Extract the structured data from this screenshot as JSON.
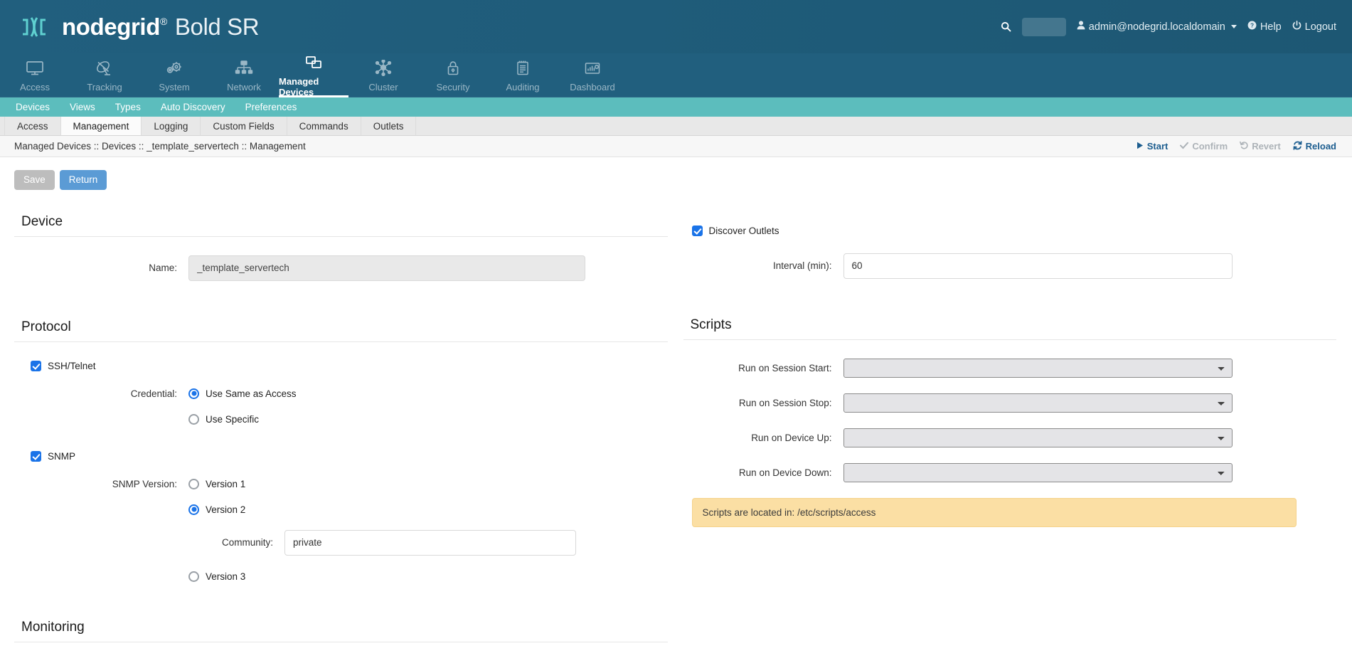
{
  "header": {
    "logo_brand": "nodegrid",
    "logo_reg": "®",
    "logo_model": "Bold SR",
    "search_icon": "search-icon",
    "search_value": "",
    "search_placeholder": "",
    "user": "admin@nodegrid.localdomain",
    "help": "Help",
    "logout": "Logout"
  },
  "mainnav": [
    {
      "label": "Access",
      "icon": "monitor-icon",
      "active": false
    },
    {
      "label": "Tracking",
      "icon": "satellite-dish-icon",
      "active": false
    },
    {
      "label": "System",
      "icon": "gears-icon",
      "active": false
    },
    {
      "label": "Network",
      "icon": "network-tree-icon",
      "active": false
    },
    {
      "label": "Managed Devices",
      "icon": "windows-stack-icon",
      "active": true
    },
    {
      "label": "Cluster",
      "icon": "nodes-hub-icon",
      "active": false
    },
    {
      "label": "Security",
      "icon": "lock-icon",
      "active": false
    },
    {
      "label": "Auditing",
      "icon": "notepad-icon",
      "active": false
    },
    {
      "label": "Dashboard",
      "icon": "bar-chart-icon",
      "active": false
    }
  ],
  "subnav": [
    {
      "label": "Devices",
      "active": true
    },
    {
      "label": "Views",
      "active": false
    },
    {
      "label": "Types",
      "active": false
    },
    {
      "label": "Auto Discovery",
      "active": false
    },
    {
      "label": "Preferences",
      "active": false
    }
  ],
  "tabs": [
    {
      "label": "Access",
      "active": false
    },
    {
      "label": "Management",
      "active": true
    },
    {
      "label": "Logging",
      "active": false
    },
    {
      "label": "Custom Fields",
      "active": false
    },
    {
      "label": "Commands",
      "active": false
    },
    {
      "label": "Outlets",
      "active": false
    }
  ],
  "breadcrumb": "Managed Devices :: Devices :: _template_servertech :: Management",
  "crumb_actions": [
    {
      "label": "Start",
      "icon": "play-icon",
      "enabled": true
    },
    {
      "label": "Confirm",
      "icon": "check-icon",
      "enabled": false
    },
    {
      "label": "Revert",
      "icon": "undo-icon",
      "enabled": false
    },
    {
      "label": "Reload",
      "icon": "refresh-icon",
      "enabled": true
    }
  ],
  "buttons": {
    "save": "Save",
    "save_enabled": false,
    "return": "Return",
    "return_enabled": true
  },
  "left": {
    "device": {
      "title": "Device",
      "name_label": "Name:",
      "name_value": "_template_servertech",
      "name_readonly": true
    },
    "protocol": {
      "title": "Protocol",
      "ssh_telnet": {
        "label": "SSH/Telnet",
        "checked": true
      },
      "credential_label": "Credential:",
      "credential_options": [
        {
          "label": "Use Same as Access",
          "selected": true
        },
        {
          "label": "Use Specific",
          "selected": false
        }
      ],
      "snmp": {
        "label": "SNMP",
        "checked": true
      },
      "snmp_version_label": "SNMP Version:",
      "snmp_versions": [
        {
          "label": "Version 1",
          "selected": false
        },
        {
          "label": "Version 2",
          "selected": true
        },
        {
          "label": "Version 3",
          "selected": false
        }
      ],
      "community_label": "Community:",
      "community_value": "private"
    },
    "monitoring": {
      "title": "Monitoring"
    }
  },
  "right": {
    "discover_outlets": {
      "label": "Discover Outlets",
      "checked": true
    },
    "interval_label": "Interval (min):",
    "interval_value": "60",
    "scripts": {
      "title": "Scripts",
      "rows": [
        {
          "label": "Run on Session Start:",
          "value": ""
        },
        {
          "label": "Run on Session Stop:",
          "value": ""
        },
        {
          "label": "Run on Device Up:",
          "value": ""
        },
        {
          "label": "Run on Device Down:",
          "value": ""
        }
      ],
      "banner": "Scripts are located in: /etc/scripts/access"
    }
  },
  "colors": {
    "header_blue": "#215f7e",
    "subnav_teal": "#5cbdbd",
    "accent_blue": "#5b9bd5",
    "link_blue": "#1c5d8f",
    "checkbox_blue": "#1a73e8",
    "banner_amber": "#fbdfa4"
  }
}
